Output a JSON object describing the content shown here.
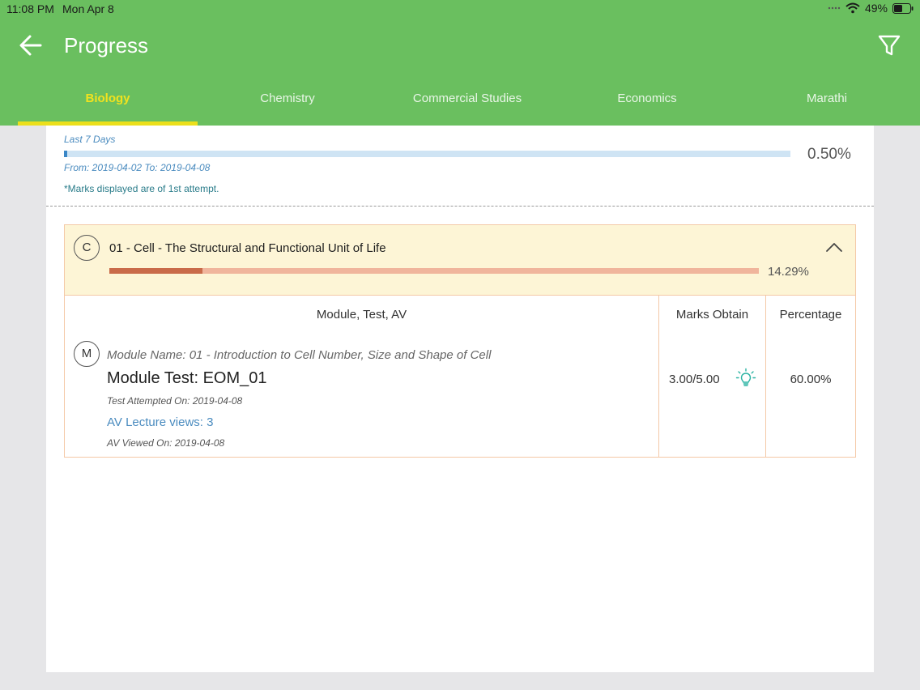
{
  "status_bar": {
    "time": "11:08 PM",
    "date": "Mon Apr 8",
    "battery": "49%"
  },
  "header": {
    "title": "Progress",
    "back_icon": "arrow-left-icon",
    "filter_icon": "filter-icon",
    "background_color": "#6abf5f"
  },
  "tabs": [
    {
      "label": "Biology",
      "active": true
    },
    {
      "label": "Chemistry",
      "active": false
    },
    {
      "label": "Commercial Studies",
      "active": false
    },
    {
      "label": "Economics",
      "active": false
    },
    {
      "label": "Marathi",
      "active": false
    }
  ],
  "summary": {
    "range_label": "Last 7 Days",
    "dates": "From: 2019-04-02 To: 2019-04-08",
    "percentage": "0.50%",
    "progress_fraction": 0.005,
    "note": "*Marks displayed are of 1st attempt."
  },
  "chapter": {
    "letter": "C",
    "title": "01 - Cell - The Structural and Functional Unit of Life",
    "percentage": "14.29%",
    "progress_fraction": 0.1429,
    "collapse_icon": "chevron-up-icon"
  },
  "table": {
    "headers": {
      "module": "Module, Test, AV",
      "marks": "Marks Obtain",
      "percentage": "Percentage"
    },
    "row": {
      "letter": "M",
      "module_name": "Module Name: 01 - Introduction to Cell Number, Size and Shape of Cell",
      "test_name": "Module Test: EOM_01",
      "test_attempted": "Test Attempted On: 2019-04-08",
      "av_views": "AV Lecture views: 3",
      "av_viewed": "AV Viewed On: 2019-04-08",
      "marks": "3.00/5.00",
      "percentage": "60.00%",
      "hint_icon": "lightbulb-icon"
    }
  }
}
